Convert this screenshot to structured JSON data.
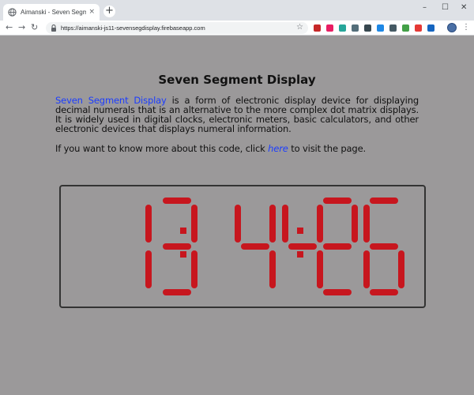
{
  "browser": {
    "tab_title": "Aimanski - Seven Segment Disp",
    "tab_close": "×",
    "new_tab": "+",
    "url": "https://aimanski-js11-sevensegdisplay.firebaseapp.com",
    "window_minimize": "–",
    "window_maximize": "☐",
    "window_close": "✕",
    "back": "←",
    "forward": "→",
    "reload": "↻",
    "star": "☆",
    "menu": "⋮",
    "extensions": [
      "#c62828",
      "#e91e63",
      "#26a69a",
      "#546e7a",
      "#37474f",
      "#1e88e5",
      "#455a64",
      "#43a047",
      "#e53935",
      "#1565c0"
    ]
  },
  "page": {
    "title": "Seven Segment Display",
    "para1_highlight": "Seven Segment Display",
    "para1_rest": " is a form of electronic display device for displaying decimal numerals that is an alternative to the more complex dot matrix displays. It is widely used in digital clocks, electronic meters, basic calculators, and other electronic devices that displays numeral information.",
    "para2_before": "If you want to know more about this code, click ",
    "para2_link": "here",
    "para2_after": " to visit the page."
  },
  "clock": {
    "digits": "134426",
    "segment_color": "#c7161e",
    "frame_color": "#333333"
  }
}
